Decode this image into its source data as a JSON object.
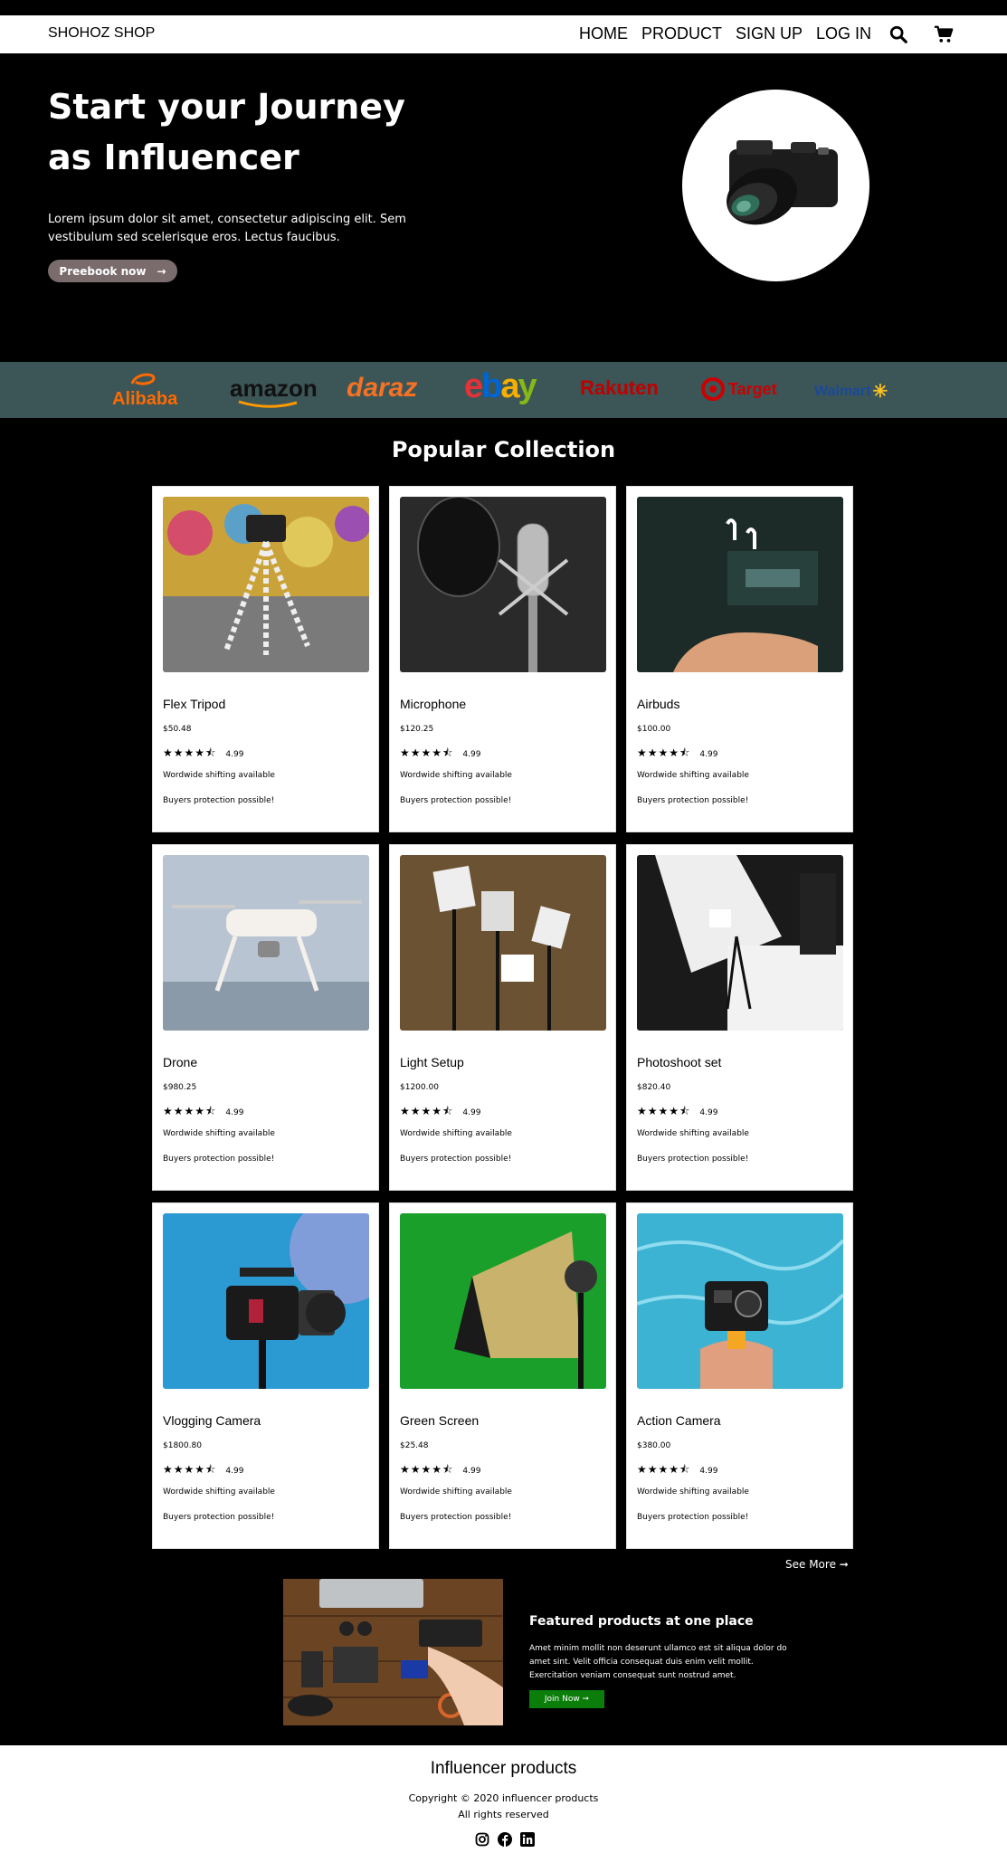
{
  "nav": {
    "brand": "SHOHOZ SHOP",
    "links": [
      "HOME",
      "PRODUCT",
      "SIGN UP",
      "LOG IN"
    ]
  },
  "hero": {
    "title": "Start your Journey as Influencer",
    "text": "Lorem ipsum dolor sit amet, consectetur adipiscing elit. Sem vestibulum sed scelerisque eros. Lectus faucibus.",
    "button": "Preebook now",
    "button_arrow": "→"
  },
  "brands": [
    {
      "name": "Alibaba",
      "color": "#ff6a00"
    },
    {
      "name": "amazon",
      "color": "#111111"
    },
    {
      "name": "daraz",
      "color": "#f57224"
    },
    {
      "name": "ebay",
      "color": "#e53238"
    },
    {
      "name": "Rakuten",
      "color": "#bf0000"
    },
    {
      "name": "Target",
      "color": "#cc0000"
    },
    {
      "name": "Walmart",
      "color": "#0071ce"
    }
  ],
  "popular": {
    "title": "Popular Collection",
    "products": [
      {
        "name": "Flex Tripod",
        "price": "$50.48",
        "rating": "4.99",
        "shipping": "Wordwide shifting available",
        "protection": "Buyers protection possible!"
      },
      {
        "name": "Microphone",
        "price": "$120.25",
        "rating": "4.99",
        "shipping": "Wordwide shifting available",
        "protection": "Buyers protection possible!"
      },
      {
        "name": "Airbuds",
        "price": "$100.00",
        "rating": "4.99",
        "shipping": "Wordwide shifting available",
        "protection": "Buyers protection possible!"
      },
      {
        "name": "Drone",
        "price": "$980.25",
        "rating": "4.99",
        "shipping": "Wordwide shifting available",
        "protection": "Buyers protection possible!"
      },
      {
        "name": "Light Setup",
        "price": "$1200.00",
        "rating": "4.99",
        "shipping": "Wordwide shifting available",
        "protection": "Buyers protection possible!"
      },
      {
        "name": "Photoshoot set",
        "price": "$820.40",
        "rating": "4.99",
        "shipping": "Wordwide shifting available",
        "protection": "Buyers protection possible!"
      },
      {
        "name": "Vlogging Camera",
        "price": "$1800.80",
        "rating": "4.99",
        "shipping": "Wordwide shifting available",
        "protection": "Buyers protection possible!"
      },
      {
        "name": "Green Screen",
        "price": "$25.48",
        "rating": "4.99",
        "shipping": "Wordwide shifting available",
        "protection": "Buyers protection possible!"
      },
      {
        "name": "Action Camera",
        "price": "$380.00",
        "rating": "4.99",
        "shipping": "Wordwide shifting available",
        "protection": "Buyers protection possible!"
      }
    ],
    "stars": "★★★★⯪",
    "see_more": "See More ➞"
  },
  "featured": {
    "title": "Featured products at one place",
    "text": "Amet minim mollit non deserunt ullamco est sit aliqua dolor do amet sint. Velit officia consequat duis enim velit mollit. Exercitation veniam consequat sunt nostrud amet.",
    "button": "Join Now ➞"
  },
  "footer": {
    "title": "Influencer products",
    "copyright": "Copyright © 2020 influencer products",
    "rights": "All rights reserved"
  }
}
